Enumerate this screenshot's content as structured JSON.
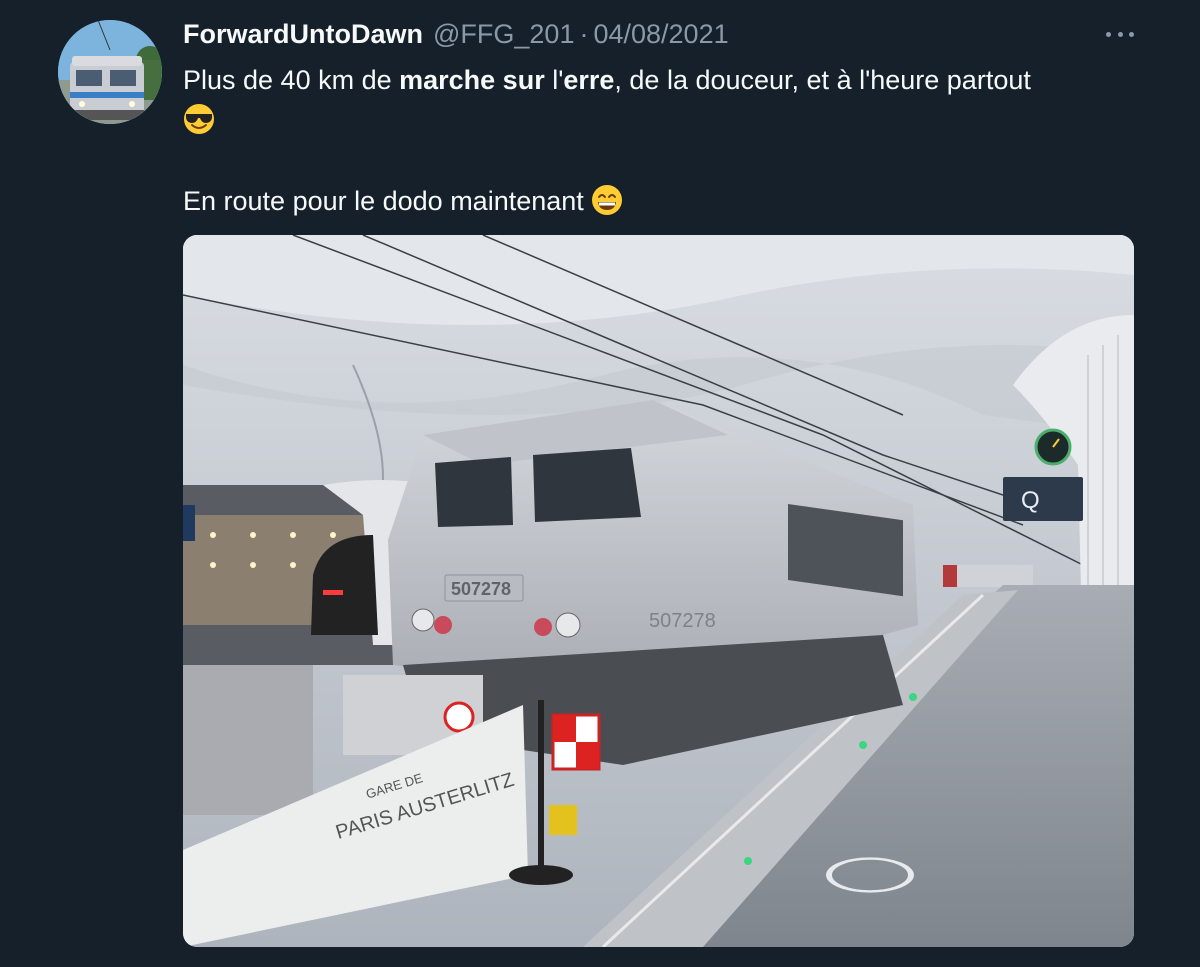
{
  "tweet": {
    "author_name": "ForwardUntoDawn",
    "handle": "@FFG_201",
    "separator": "·",
    "date": "04/08/2021",
    "text": {
      "p1_a": "Plus de 40 km de ",
      "p1_b": "marche sur",
      "p1_c": " l'",
      "p1_d": "erre",
      "p1_e": ", de la douceur, et à l'heure partout",
      "emoji_1": "smiling-face-with-sunglasses",
      "p2": "En route pour le dodo maintenant ",
      "emoji_2": "beaming-face-with-smiling-eyes"
    },
    "more_icon": "more-horizontal-icon"
  },
  "photo": {
    "locomotive_number": "507278",
    "banner_line1": "GARE DE",
    "banner_line2": "PARIS AUSTERLITZ",
    "platform_sign": "Q"
  },
  "colors": {
    "background": "#15202b",
    "primary_text": "#f7f9f9",
    "secondary_text": "#8b98a5"
  }
}
